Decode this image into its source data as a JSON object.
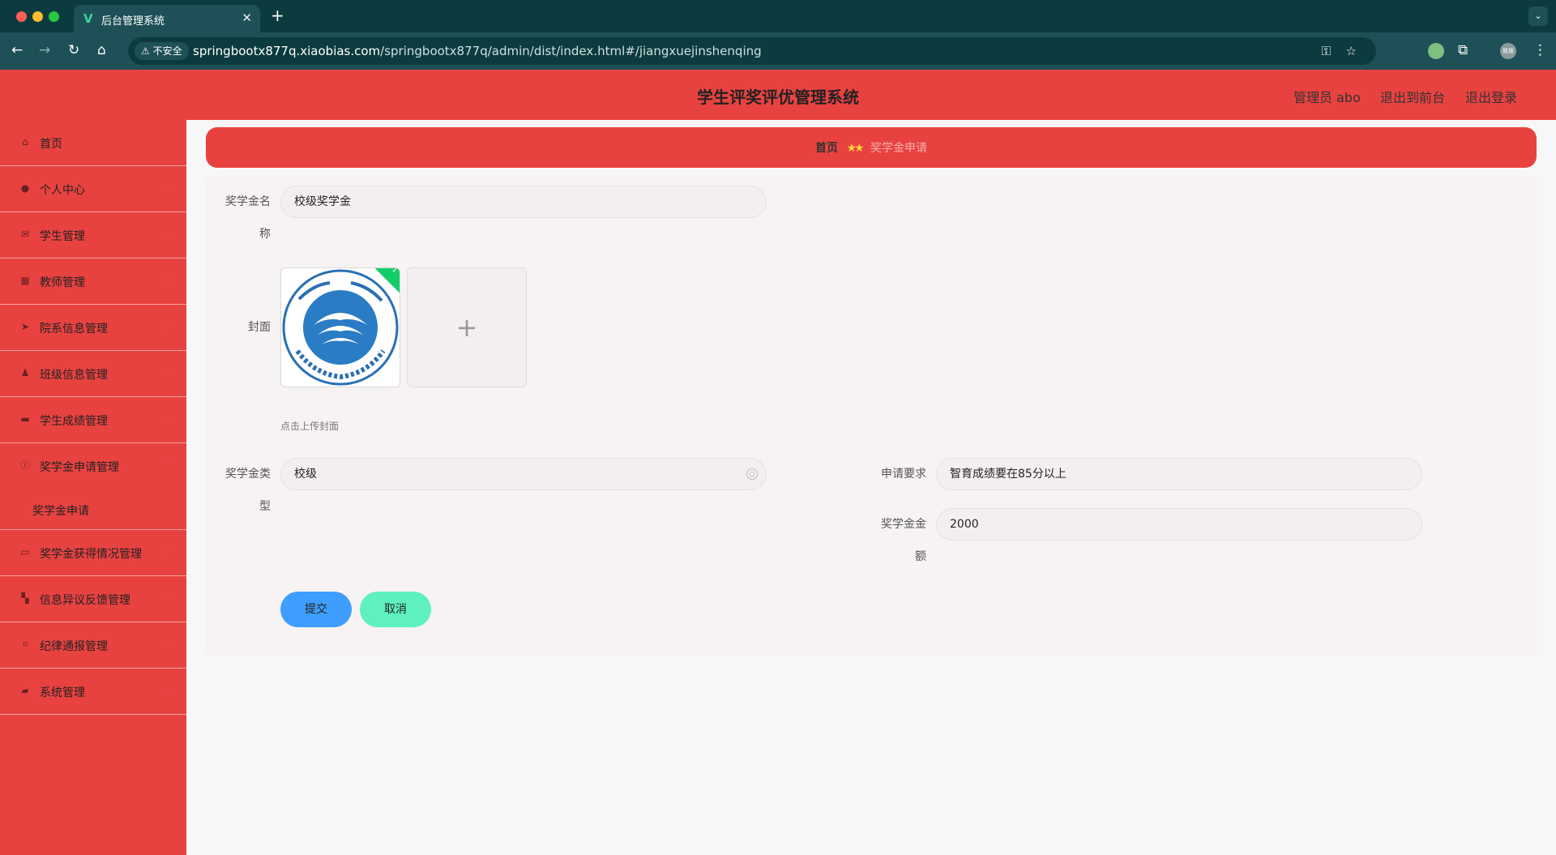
{
  "browser": {
    "tab_title": "后台管理系统",
    "tab_logo": "V",
    "url_host": "springbootx877q.xiaobias.com",
    "url_path": "/springbootx877q/admin/dist/index.html#/jiangxuejinshenqing",
    "insecure_label": "不安全",
    "profile_label": "致致"
  },
  "header": {
    "title": "学生评奖评优管理系统",
    "admin_label": "管理员 abo",
    "front_link": "退出到前台",
    "logout_link": "退出登录"
  },
  "sidebar": {
    "items": [
      {
        "label": "首页",
        "icon": "home-icon",
        "chevron": false
      },
      {
        "label": "个人中心",
        "icon": "user-icon",
        "chevron": true
      },
      {
        "label": "学生管理",
        "icon": "mail-icon",
        "chevron": true
      },
      {
        "label": "教师管理",
        "icon": "chart-icon",
        "chevron": true
      },
      {
        "label": "院系信息管理",
        "icon": "send-icon",
        "chevron": true
      },
      {
        "label": "班级信息管理",
        "icon": "person-icon",
        "chevron": true
      },
      {
        "label": "学生成绩管理",
        "icon": "briefcase-icon",
        "chevron": true
      },
      {
        "label": "奖学金申请管理",
        "icon": "info-icon",
        "chevron": true,
        "expanded": true
      },
      {
        "label": "奖学金申请",
        "submenu": true
      },
      {
        "label": "奖学金获得情况管理",
        "icon": "card-icon",
        "chevron": true
      },
      {
        "label": "信息异议反馈管理",
        "icon": "grid-icon",
        "chevron": true
      },
      {
        "label": "纪律通报管理",
        "icon": "crop-icon",
        "chevron": true
      },
      {
        "label": "系统管理",
        "icon": "chat-icon",
        "chevron": true
      }
    ]
  },
  "breadcrumb": {
    "home": "首页",
    "separator": "★★",
    "current": "奖学金申请"
  },
  "form": {
    "name_label_1": "奖学金名",
    "name_label_2": "称",
    "name_value": "校级奖学金",
    "cover_label": "封面",
    "cover_image": "university-logo",
    "upload_hint": "点击上传封面",
    "type_label_1": "奖学金类",
    "type_label_2": "型",
    "type_value": "校级",
    "requirement_label": "申请要求",
    "requirement_value": "智育成绩要在85分以上",
    "amount_label_1": "奖学金金",
    "amount_label_2": "额",
    "amount_value": "2000",
    "submit_label": "提交",
    "cancel_label": "取消"
  },
  "colors": {
    "brand_red": "#e84240",
    "submit_blue": "#3d9eff",
    "cancel_green": "#5ef0c0",
    "chrome_teal": "#1e5157"
  }
}
